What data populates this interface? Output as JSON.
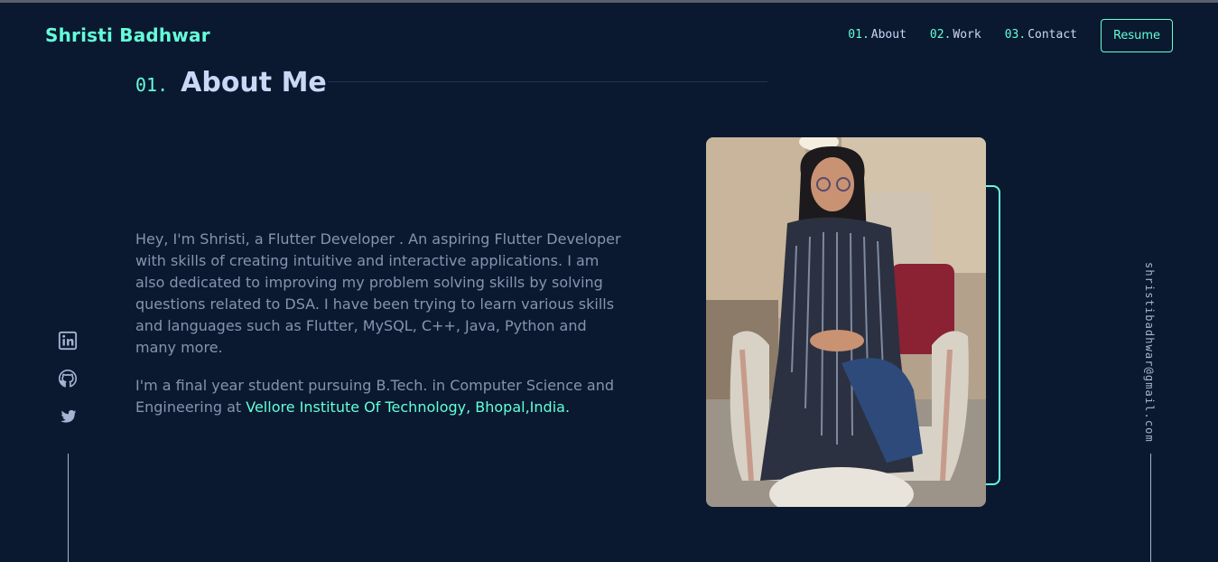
{
  "header": {
    "logo": "Shristi Badhwar",
    "nav": [
      {
        "num": "01.",
        "label": "About"
      },
      {
        "num": "02.",
        "label": "Work"
      },
      {
        "num": "03.",
        "label": "Contact"
      }
    ],
    "resume_label": "Resume"
  },
  "about": {
    "num": "01.",
    "title": "About Me",
    "para1": "Hey, I'm Shristi, a Flutter Developer . An aspiring Flutter Developer with skills of creating intuitive and interactive applications. I am also dedicated to improving my problem solving skills by solving questions related to DSA. I have been trying to learn various skills and languages such as Flutter, MySQL, C++, Java, Python and many more.",
    "para2_prefix": "I'm a final year student pursuing B.Tech. in Computer Science and Engineering at ",
    "para2_link": "Vellore Institute Of Technology, Bhopal,India."
  },
  "social": [
    {
      "icon": "linkedin-icon"
    },
    {
      "icon": "github-icon"
    },
    {
      "icon": "twitter-icon"
    }
  ],
  "email": "shristibadhwar@gmail.com",
  "colors": {
    "background": "#0a192f",
    "accent": "#64ffda",
    "heading": "#ccd6f6",
    "text": "#8892b0"
  }
}
